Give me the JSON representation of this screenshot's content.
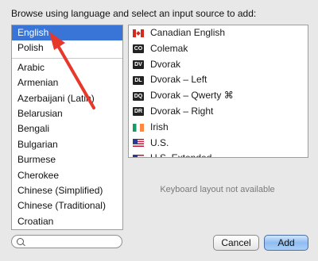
{
  "prompt": "Browse using language and select an input source to add:",
  "languages": [
    {
      "label": "English",
      "selected": true
    },
    {
      "label": "Polish"
    },
    {
      "separator": true
    },
    {
      "label": "Arabic"
    },
    {
      "label": "Armenian"
    },
    {
      "label": "Azerbaijani (Latin)"
    },
    {
      "label": "Belarusian"
    },
    {
      "label": "Bengali"
    },
    {
      "label": "Bulgarian"
    },
    {
      "label": "Burmese"
    },
    {
      "label": "Cherokee"
    },
    {
      "label": "Chinese (Simplified)"
    },
    {
      "label": "Chinese (Traditional)"
    },
    {
      "label": "Croatian"
    }
  ],
  "sources": [
    {
      "label": "Canadian English",
      "icon": "flag-canada-icon",
      "badge": ""
    },
    {
      "label": "Colemak",
      "icon": "colemak-layout-icon",
      "badge": "CO"
    },
    {
      "label": "Dvorak",
      "icon": "dvorak-layout-icon",
      "badge": "DV"
    },
    {
      "label": "Dvorak – Left",
      "icon": "dvorak-left-layout-icon",
      "badge": "DL"
    },
    {
      "label": "Dvorak – Qwerty ⌘",
      "icon": "dvorak-qwerty-layout-icon",
      "badge": "DQ"
    },
    {
      "label": "Dvorak – Right",
      "icon": "dvorak-right-layout-icon",
      "badge": "DR"
    },
    {
      "label": "Irish",
      "icon": "flag-ireland-icon",
      "badge": ""
    },
    {
      "label": "U.S.",
      "icon": "flag-us-icon",
      "badge": ""
    },
    {
      "label": "U.S. Extended",
      "icon": "flag-us-icon",
      "badge": ""
    }
  ],
  "preview_note": "Keyboard layout not available",
  "search": {
    "placeholder": "",
    "value": ""
  },
  "buttons": {
    "cancel": "Cancel",
    "add": "Add"
  },
  "colors": {
    "selection": "#3875d7",
    "arrow": "#e8372b",
    "default_button": "#8fbcf1"
  }
}
